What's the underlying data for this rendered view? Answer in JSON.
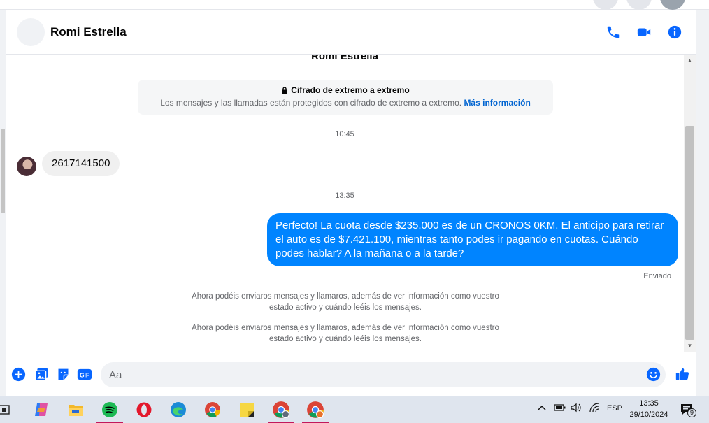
{
  "header": {
    "contact_name": "Romi Estrella"
  },
  "conversation": {
    "peek_title": "Romi Estrella",
    "encryption": {
      "title": "Cifrado de extremo a extremo",
      "text": "Los mensajes y las llamadas están protegidos con cifrado de extremo a extremo.",
      "link": "Más información"
    },
    "timestamp_1": "10:45",
    "incoming_message": "2617141500",
    "timestamp_2": "13:35",
    "outgoing_message": "Perfecto! La cuota desde $235.000 es de un CRONOS 0KM. El anticipo para retirar el auto es de $7.421.100, mientras tanto podes ir pagando en cuotas. Cuándo podes hablar? A la mañana o a la tarde?",
    "status": "Enviado",
    "notices": [
      "Ahora podéis enviaros mensajes y llamaros, además de ver información como vuestro estado activo y cuándo leéis los mensajes.",
      "Ahora podéis enviaros mensajes y llamaros, además de ver información como vuestro estado activo y cuándo leéis los mensajes."
    ]
  },
  "composer": {
    "placeholder": "Aa"
  },
  "taskbar": {
    "language": "ESP",
    "time": "13:35",
    "date": "29/10/2024",
    "notification_count": "9"
  },
  "colors": {
    "accent": "#0084ff",
    "icon_blue": "#0866ff",
    "link": "#0064d1"
  }
}
